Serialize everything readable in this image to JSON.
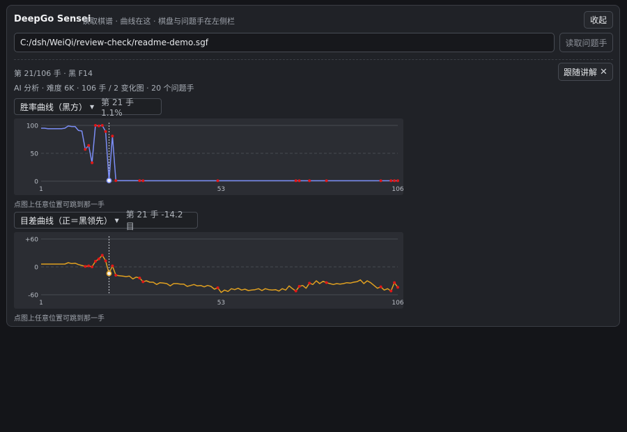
{
  "header": {
    "title": "DeepGo Sensei",
    "subtitle": "读取棋谱 · 曲线在这 · 棋盘与问题手在左侧栏",
    "collapse_label": "收起"
  },
  "file": {
    "path": "C:/dsh/WeiQi/review-check/readme-demo.sgf",
    "load_label": "读取问题手"
  },
  "status": {
    "move_info": "第 21/106 手 · 黑 F14",
    "analysis_info": "AI 分析 · 难度 6K · 106 手 / 2 变化图 · 20 个问题手",
    "follow_label": "跟随讲解"
  },
  "charts_ui": [
    {
      "select_label": "胜率曲线（黑方）",
      "readout": "第 21 手 1.1%",
      "hint": "点图上任意位置可跳到那一手"
    },
    {
      "select_label": "目差曲线（正＝黑领先）",
      "readout": "第 21 手 -14.2 目",
      "hint": "点图上任意位置可跳到那一手"
    }
  ],
  "chart_data": [
    {
      "type": "line",
      "title": "胜率曲线（黑方）",
      "xlim": [
        1,
        106
      ],
      "ylim": [
        0,
        100
      ],
      "x_ticks": [
        "1",
        "53",
        "106"
      ],
      "y_ticks": [
        "100",
        "50",
        "0"
      ],
      "grid": true,
      "color": "#7b8df5",
      "current_move": 21,
      "current_value": 1.1,
      "series": [
        {
          "values": [
            95,
            95,
            94,
            94,
            94,
            94,
            94,
            95,
            99,
            98,
            98,
            91,
            90,
            57,
            64,
            33,
            100,
            99,
            100,
            89,
            1.1,
            81,
            1,
            1,
            1,
            1,
            1,
            1,
            1,
            1,
            0.8,
            0.8,
            0.8,
            0.8,
            0.8,
            0.8,
            0.8,
            0.8,
            0.8,
            0.8,
            0.8,
            0.8,
            0.8,
            0.8,
            0.8,
            0.8,
            0.8,
            0.8,
            0.8,
            0.8,
            0.8,
            0.8,
            0.8,
            0.8,
            0.8,
            0.8,
            0.8,
            0.8,
            0.8,
            0.8,
            0.8,
            0.8,
            0.8,
            0.8,
            0.8,
            0.8,
            0.8,
            0.8,
            0.8,
            0.8,
            0.8,
            0.8,
            0.8,
            0.8,
            0.8,
            0.8,
            0.8,
            0.8,
            0.8,
            0.8,
            0.8,
            0.8,
            0.8,
            0.8,
            0.8,
            0.8,
            0.8,
            0.8,
            0.8,
            0.8,
            0.8,
            0.8,
            0.8,
            0.8,
            0.8,
            0.8,
            0.8,
            0.8,
            0.8,
            0.8,
            0.8,
            0.8,
            0.8,
            0.8,
            0.8,
            0.8
          ]
        }
      ],
      "problem_moves": [
        14,
        15,
        16,
        17,
        18,
        19,
        20,
        22,
        23,
        30,
        31,
        53,
        76,
        77,
        80,
        85,
        101,
        104,
        105,
        106
      ]
    },
    {
      "type": "line",
      "title": "目差曲线（正＝黑领先）",
      "xlim": [
        1,
        106
      ],
      "ylim": [
        -60,
        60
      ],
      "x_ticks": [
        "1",
        "53",
        "106"
      ],
      "y_ticks": [
        "+60",
        "0",
        "-60"
      ],
      "grid": true,
      "color": "#e0a020",
      "current_move": 21,
      "current_value": -14.2,
      "series": [
        {
          "values": [
            6,
            6,
            6,
            6,
            6,
            6,
            6,
            6,
            9,
            7,
            8,
            5,
            3,
            1,
            2,
            0,
            12,
            17,
            25,
            13,
            -14.2,
            2,
            -18,
            -19,
            -20,
            -21,
            -20,
            -26,
            -22,
            -24,
            -32,
            -30,
            -33,
            -33,
            -38,
            -34,
            -35,
            -36,
            -41,
            -36,
            -36,
            -37,
            -37,
            -42,
            -40,
            -38,
            -41,
            -40,
            -43,
            -40,
            -42,
            -48,
            -45,
            -55,
            -50,
            -53,
            -47,
            -49,
            -46,
            -50,
            -48,
            -51,
            -50,
            -49,
            -47,
            -51,
            -47,
            -49,
            -50,
            -49,
            -52,
            -47,
            -50,
            -41,
            -47,
            -52,
            -42,
            -40,
            -46,
            -35,
            -38,
            -30,
            -36,
            -31,
            -34,
            -36,
            -38,
            -36,
            -37,
            -36,
            -34,
            -35,
            -33,
            -32,
            -28,
            -36,
            -30,
            -34,
            -40,
            -46,
            -43,
            -50,
            -47,
            -52,
            -34,
            -44
          ]
        }
      ],
      "problem_moves": [
        14,
        15,
        16,
        17,
        18,
        19,
        20,
        22,
        23,
        30,
        31,
        53,
        76,
        77,
        80,
        85,
        101,
        104,
        105,
        106
      ]
    }
  ]
}
